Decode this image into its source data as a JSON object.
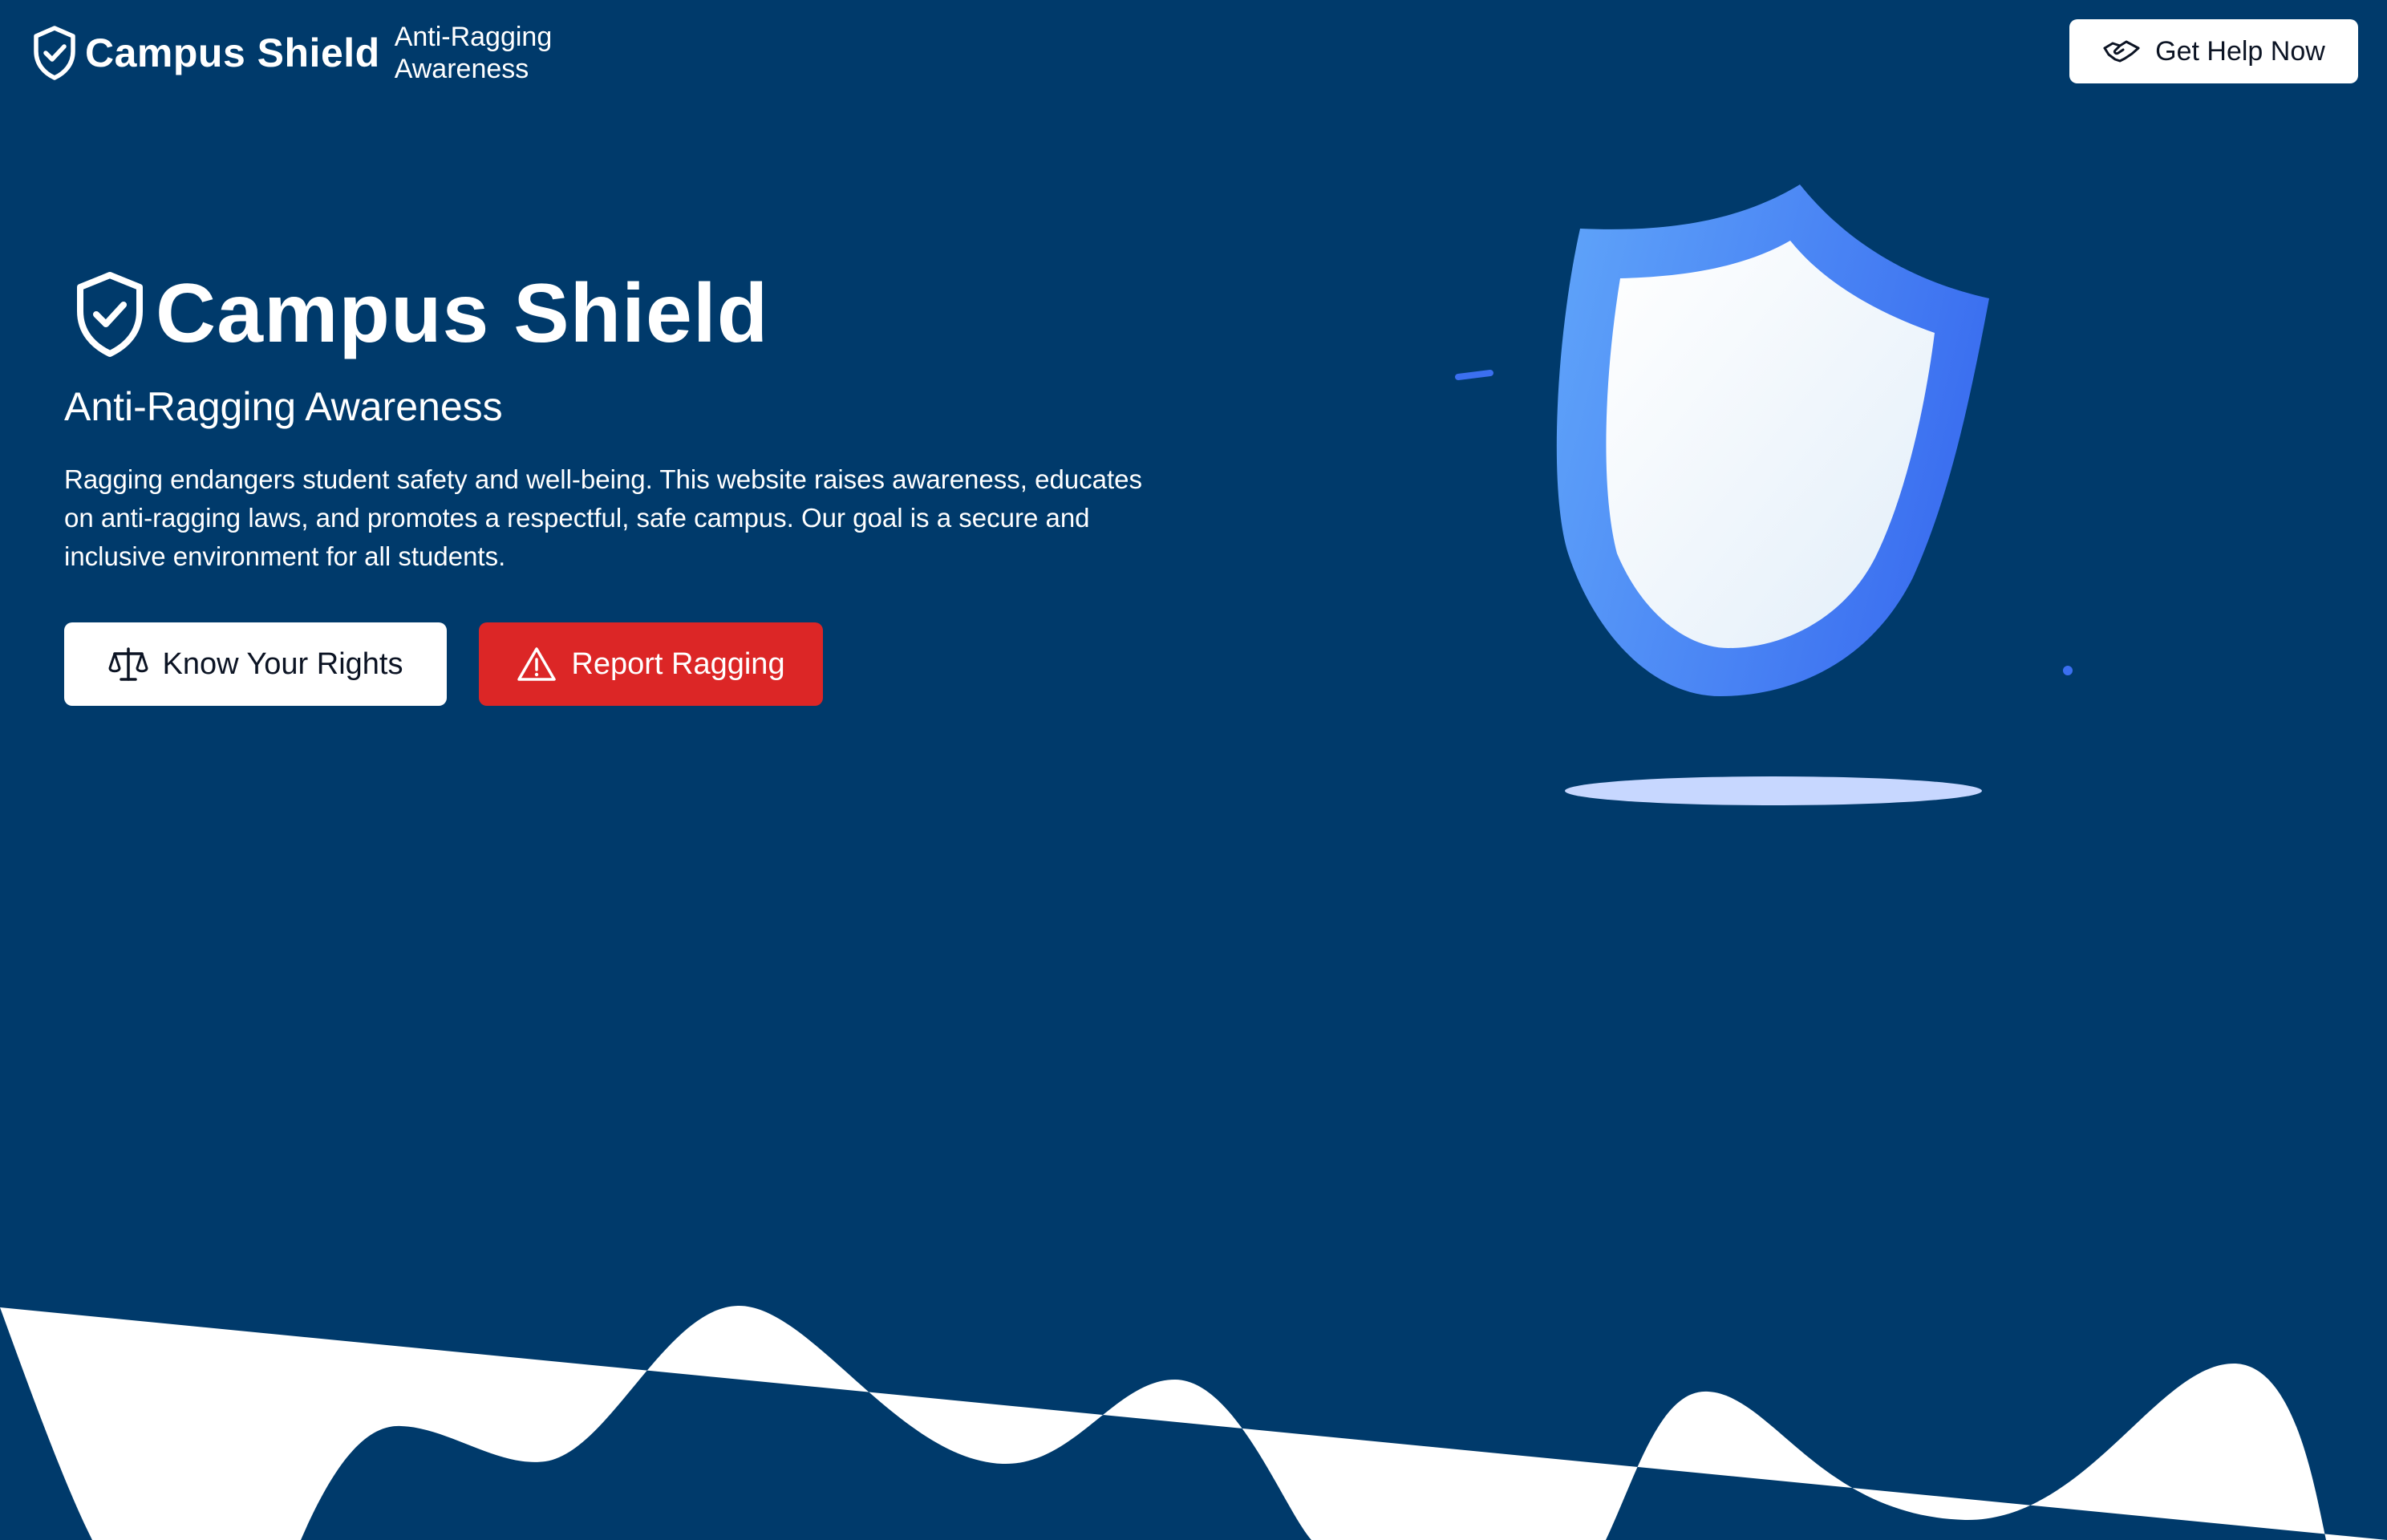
{
  "header": {
    "brand_name": "Campus Shield",
    "tagline_line1": "Anti-Ragging",
    "tagline_line2": "Awareness",
    "help_button_label": "Get Help Now",
    "help_icon": "handshake-icon",
    "brand_icon": "shield-check-icon"
  },
  "hero": {
    "title": "Campus Shield",
    "title_icon": "shield-check-icon",
    "subtitle": "Anti-Ragging Awareness",
    "description": "Ragging endangers student safety and well-being. This website raises awareness, educates on anti-ragging laws, and promotes a respectful, safe campus. Our goal is a secure and inclusive environment for all students.",
    "primary_button": {
      "label": "Know Your Rights",
      "icon": "scales-icon"
    },
    "secondary_button": {
      "label": "Report Ragging",
      "icon": "warning-triangle-icon"
    }
  },
  "illustration": {
    "icon": "shield-illustration",
    "colors": {
      "shield_outer_start": "#60a5fa",
      "shield_outer_end": "#3b6ff0",
      "shield_inner": "#f0f6fc",
      "shadow": "#c7d7ff",
      "accent": "#3b6ff0"
    }
  },
  "colors": {
    "background": "#003a6b",
    "report_button": "#dc2626",
    "wave": "#ffffff"
  }
}
